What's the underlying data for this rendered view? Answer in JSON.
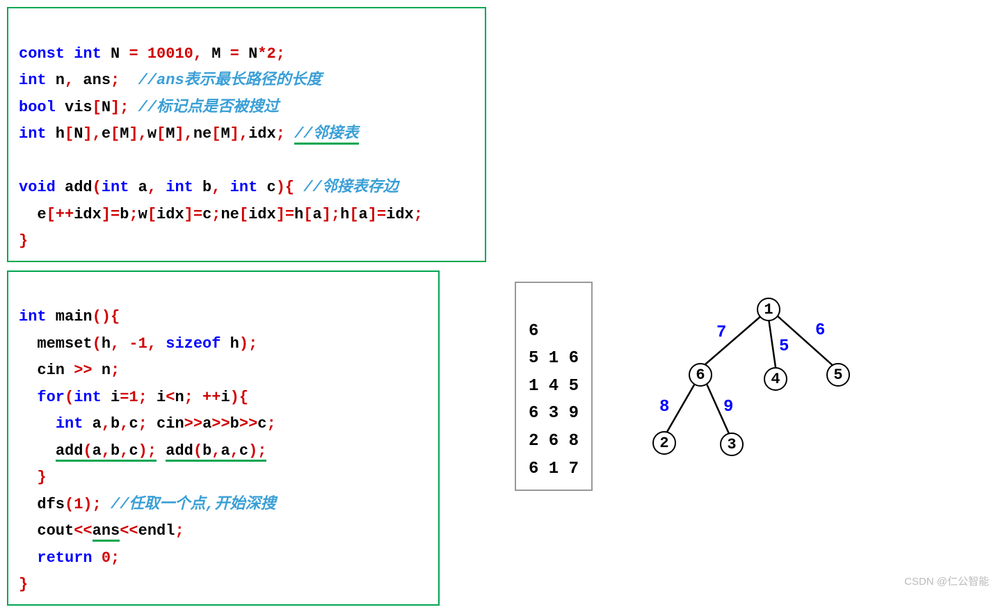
{
  "code_block_1": {
    "l1": {
      "a": "const int",
      "b": " N ",
      "c": "=",
      "d": " 10010",
      "e": ",",
      "f": " M ",
      "g": "=",
      "h": " N",
      "i": "*",
      "j": "2",
      "k": ";"
    },
    "l2": {
      "a": "int",
      "b": " n",
      "c": ",",
      "d": " ans",
      "e": ";",
      "sp": "  ",
      "cmt": "//ans表示最长路径的长度"
    },
    "l3": {
      "a": "bool",
      "b": " vis",
      "c": "[",
      "d": "N",
      "e": "];",
      "sp": " ",
      "cmt": "//标记点是否被搜过"
    },
    "l4": {
      "a": "int",
      "b": " h",
      "c": "[",
      "d": "N",
      "e": "],",
      "f": "e",
      "g": "[",
      "h": "M",
      "i": "],",
      "j": "w",
      "k": "[",
      "l": "M",
      "m": "],",
      "n": "ne",
      "o": "[",
      "p": "M",
      "q": "],",
      "r": "idx",
      "s": ";",
      "sp": " ",
      "cmt": "//邻接表"
    },
    "l5": "",
    "l6": {
      "a": "void",
      "b": " add",
      "c": "(",
      "d": "int",
      "e": " a",
      "f": ",",
      "g": " int",
      "h": " b",
      "i": ",",
      "j": " int",
      "k": " c",
      "l": "){",
      "sp": " ",
      "cmt": "//邻接表存边"
    },
    "l7": {
      "pre": "  ",
      "a": "e",
      "b": "[++",
      "c": "idx",
      "d": "]=",
      "e": "b",
      "f": ";",
      "g": "w",
      "h": "[",
      "i": "idx",
      "j": "]=",
      "k": "c",
      "l": ";",
      "m": "ne",
      "n": "[",
      "o": "idx",
      "p": "]=",
      "q": "h",
      "r": "[",
      "s": "a",
      "t": "];",
      "u": "h",
      "v": "[",
      "w": "a",
      "x": "]=",
      "y": "idx",
      "z": ";"
    },
    "l8": {
      "a": "}"
    }
  },
  "code_block_2": {
    "l1": {
      "a": "int",
      "b": " main",
      "c": "(){"
    },
    "l2": {
      "pre": "  ",
      "a": "memset",
      "b": "(",
      "c": "h",
      "d": ",",
      "e": " -1",
      "f": ",",
      "g": " sizeof",
      "h": " h",
      "i": ");"
    },
    "l3": {
      "pre": "  ",
      "a": "cin ",
      "b": ">>",
      "c": " n",
      "d": ";"
    },
    "l4": {
      "pre": "  ",
      "a": "for",
      "b": "(",
      "c": "int",
      "d": " i",
      "e": "=",
      "f": "1",
      "g": ";",
      "h": " i",
      "i": "<",
      "j": "n",
      "k": ";",
      "l": " ++",
      "m": "i",
      "n": "){"
    },
    "l5": {
      "pre": "    ",
      "a": "int",
      "b": " a",
      "c": ",",
      "d": "b",
      "e": ",",
      "f": "c",
      "g": ";",
      "h": " cin",
      "i": ">>",
      "j": "a",
      "k": ">>",
      "l": "b",
      "m": ">>",
      "n": "c",
      "o": ";"
    },
    "l6": {
      "pre": "    ",
      "a": "add",
      "b": "(",
      "c": "a",
      "d": ",",
      "e": "b",
      "f": ",",
      "g": "c",
      "h": ");",
      "sp": " ",
      "i": "add",
      "j": "(",
      "k": "b",
      "l": ",",
      "m": "a",
      "n": ",",
      "o": "c",
      "p": ");"
    },
    "l7": {
      "pre": "  ",
      "a": "}"
    },
    "l8": {
      "pre": "  ",
      "a": "dfs",
      "b": "(",
      "c": "1",
      "d": ");",
      "sp": " ",
      "cmt": "//任取一个点,开始深搜"
    },
    "l9": {
      "pre": "  ",
      "a": "cout",
      "b": "<<",
      "c": "ans",
      "d": "<<",
      "e": "endl",
      "f": ";"
    },
    "l10": {
      "pre": "  ",
      "a": "return",
      "b": " 0",
      "c": ";"
    },
    "l11": {
      "a": "}"
    }
  },
  "input_data": {
    "l1": "6",
    "l2": "5 1 6",
    "l3": "1 4 5",
    "l4": "6 3 9",
    "l5": "2 6 8",
    "l6": "6 1 7"
  },
  "tree": {
    "nodes": {
      "n1": "1",
      "n2": "2",
      "n3": "3",
      "n4": "4",
      "n5": "5",
      "n6": "6"
    },
    "edge_weights": {
      "e16": "7",
      "e14": "5",
      "e15": "6",
      "e62": "8",
      "e63": "9"
    }
  },
  "watermark": "CSDN @仁公智能"
}
